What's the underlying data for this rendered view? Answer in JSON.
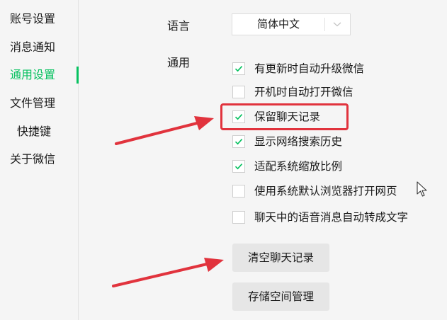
{
  "sidebar": {
    "items": [
      {
        "label": "账号设置"
      },
      {
        "label": "消息通知"
      },
      {
        "label": "通用设置"
      },
      {
        "label": "文件管理"
      },
      {
        "label": "快捷键"
      },
      {
        "label": "关于微信"
      }
    ],
    "active_index": 2
  },
  "language": {
    "label": "语言",
    "value": "简体中文"
  },
  "general": {
    "label": "通用",
    "options": [
      {
        "label": "有更新时自动升级微信",
        "checked": true
      },
      {
        "label": "开机时自动打开微信",
        "checked": false
      },
      {
        "label": "保留聊天记录",
        "checked": true
      },
      {
        "label": "显示网络搜索历史",
        "checked": true
      },
      {
        "label": "适配系统缩放比例",
        "checked": true
      },
      {
        "label": "使用系统默认浏览器打开网页",
        "checked": false
      },
      {
        "label": "聊天中的语音消息自动转成文字",
        "checked": false
      }
    ]
  },
  "buttons": {
    "clear_chat": "清空聊天记录",
    "storage": "存储空间管理"
  },
  "colors": {
    "accent": "#07c160",
    "annotation": "#e1333d",
    "background": "#f5f5f5"
  },
  "icons": {
    "checkbox_mark": "checkmark-icon",
    "select_caret": "chevron-down-icon",
    "cursor": "mouse-pointer-icon",
    "annotation": "red-arrow-icon"
  }
}
